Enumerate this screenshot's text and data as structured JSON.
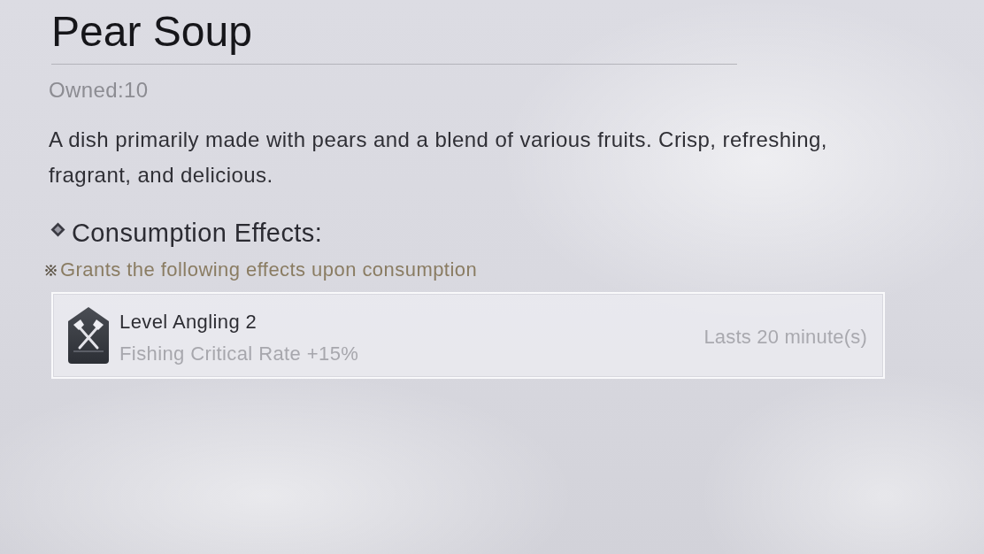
{
  "item": {
    "title": "Pear Soup",
    "owned": "Owned:10",
    "description": "A dish primarily made with pears and a blend of various fruits. Crisp, refreshing, fragrant, and delicious."
  },
  "effects_section": {
    "heading": "Consumption Effects:",
    "note": "Grants the following effects upon consumption"
  },
  "effects": [
    {
      "name": "Level Angling 2",
      "detail": "Fishing Critical Rate +15%",
      "duration": "Lasts 20 minute(s)"
    }
  ]
}
